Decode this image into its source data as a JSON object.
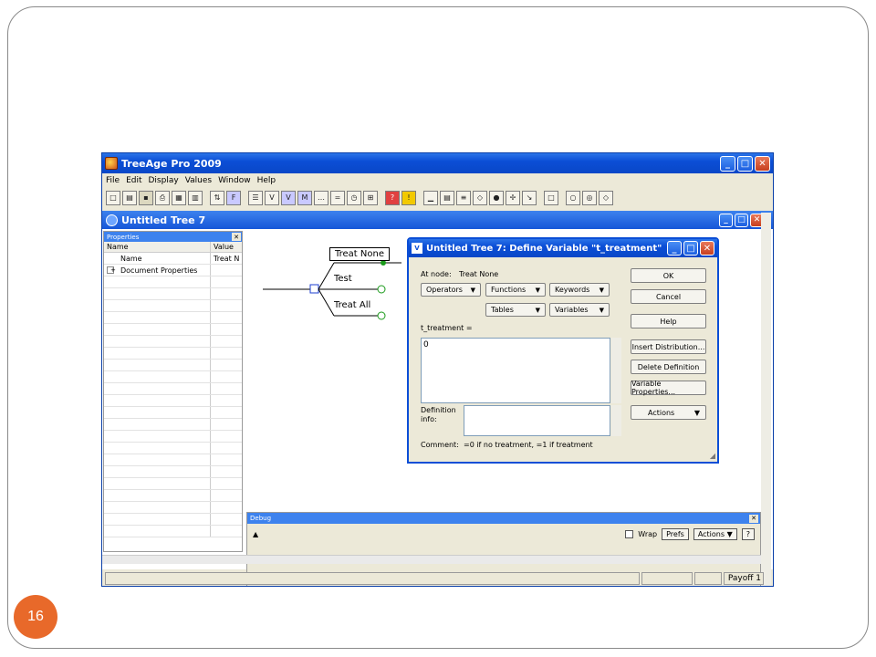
{
  "slide": {
    "page_number": "16"
  },
  "app": {
    "title": "TreeAge Pro 2009",
    "menu": [
      "File",
      "Edit",
      "Display",
      "Values",
      "Window",
      "Help"
    ],
    "toolbar_icons": [
      {
        "name": "new-icon",
        "glyph": "□"
      },
      {
        "name": "open-icon",
        "glyph": "▤"
      },
      {
        "name": "save-icon",
        "glyph": "▪"
      },
      {
        "name": "print-icon",
        "glyph": "⎙"
      },
      {
        "name": "print-preview-icon",
        "glyph": "▦"
      },
      {
        "name": "layout-icon",
        "glyph": "▥"
      },
      {
        "name": "node-sort-icon",
        "glyph": "⇅"
      },
      {
        "name": "function-icon",
        "glyph": "F"
      },
      {
        "name": "tree-icon",
        "glyph": "☰"
      },
      {
        "name": "variables-icon",
        "glyph": "V"
      },
      {
        "name": "define-variable-icon",
        "glyph": "V"
      },
      {
        "name": "markov-icon",
        "glyph": "M"
      },
      {
        "name": "dots-icon",
        "glyph": "…"
      },
      {
        "name": "equals-icon",
        "glyph": "="
      },
      {
        "name": "clock-icon",
        "glyph": "◷"
      },
      {
        "name": "network-icon",
        "glyph": "⊞"
      },
      {
        "name": "help-icon",
        "glyph": "?"
      },
      {
        "name": "warning-icon",
        "glyph": "!"
      },
      {
        "name": "bar-chart-icon",
        "glyph": "▁"
      },
      {
        "name": "table-icon",
        "glyph": "▤"
      },
      {
        "name": "sens-icon",
        "glyph": "≡"
      },
      {
        "name": "shape-icon",
        "glyph": "◇"
      },
      {
        "name": "sphere-icon",
        "glyph": "●"
      },
      {
        "name": "move-icon",
        "glyph": "✢"
      },
      {
        "name": "arrow-tool-icon",
        "glyph": "↘"
      },
      {
        "name": "square-node-icon",
        "glyph": "□"
      },
      {
        "name": "circle-node-icon",
        "glyph": "○"
      },
      {
        "name": "double-circle-node-icon",
        "glyph": "◎"
      },
      {
        "name": "diamond-node-icon",
        "glyph": "◇"
      }
    ]
  },
  "tree_window": {
    "title": "Untitled Tree 7",
    "nodes": {
      "treat_none": "Treat None",
      "test": "Test",
      "treat_all": "Treat All"
    }
  },
  "properties": {
    "title": "Properties",
    "columns": [
      "Name",
      "Value"
    ],
    "rows": [
      {
        "name": "Name",
        "value": "Treat N"
      },
      {
        "name": "Document Properties",
        "value": ""
      }
    ],
    "expand_glyph": "+"
  },
  "debug": {
    "title": "Debug",
    "wrap_label": "Wrap",
    "prefs_label": "Prefs",
    "actions_label": "Actions",
    "help_label": "?"
  },
  "status": {
    "payoff": "Payoff 1"
  },
  "dialog": {
    "title": "Untitled Tree 7: Define Variable \"t_treatment\"",
    "at_node_label": "At node:",
    "at_node_value": "Treat None",
    "dropdowns": {
      "operators": "Operators",
      "functions": "Functions",
      "keywords": "Keywords",
      "tables": "Tables",
      "variables": "Variables"
    },
    "var_label": "t_treatment =",
    "definition_value": "0",
    "definition_info_label": "Definition info:",
    "definition_info_value": "",
    "comment_label": "Comment:",
    "comment_value": "=0 if no treatment, =1 if treatment",
    "buttons": {
      "ok": "OK",
      "cancel": "Cancel",
      "help": "Help",
      "insert_distribution": "Insert Distribution...",
      "delete_definition": "Delete Definition",
      "variable_properties": "Variable Properties...",
      "actions": "Actions"
    }
  },
  "colors": {
    "accent": "#e8692a",
    "titlebar": "#0b4ed6",
    "window_face": "#ece9d8"
  }
}
